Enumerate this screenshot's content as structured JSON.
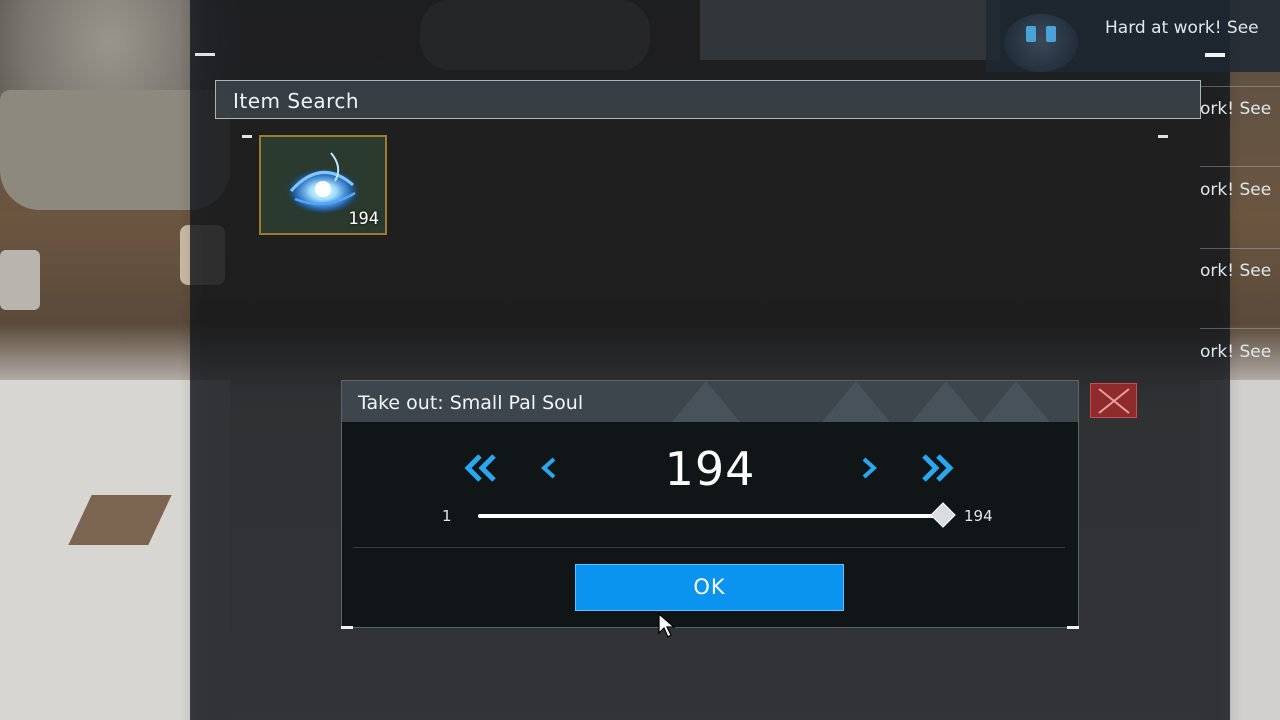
{
  "notifications": {
    "lines": [
      "Hard at work! See",
      "ork! See",
      "ork! See",
      "ork! See",
      "ork! See"
    ]
  },
  "item_search": {
    "title": "Item Search",
    "items": [
      {
        "icon": "pal-soul-icon",
        "count": "194"
      }
    ]
  },
  "dialog": {
    "title": "Take out: Small Pal Soul",
    "quantity": "194",
    "slider": {
      "min": "1",
      "max": "194",
      "value_fraction": 1.0
    },
    "ok_label": "OK",
    "accent_color": "#29a8f0",
    "ok_color": "#0a94f0",
    "close_color": "#8f2b2b"
  }
}
